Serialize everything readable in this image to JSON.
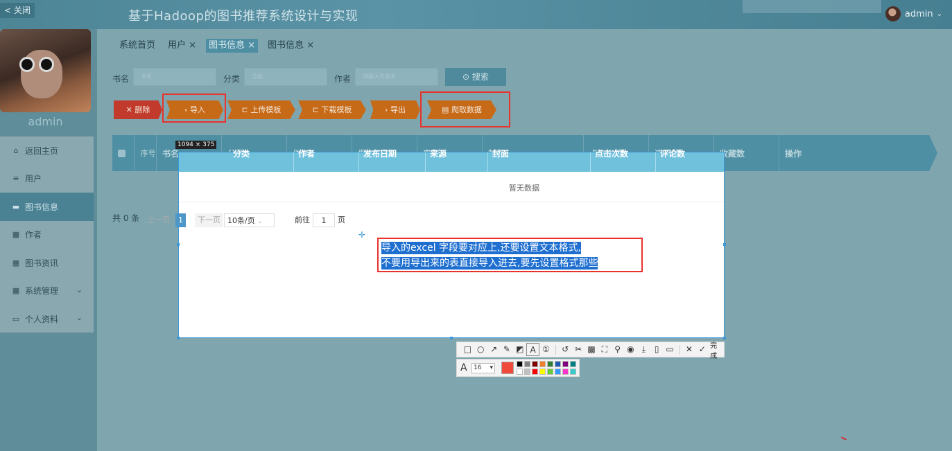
{
  "header": {
    "close_label": "< 关闭",
    "title": "基于Hadoop的图书推荐系统设计与实现",
    "username": "admin"
  },
  "sidebar": {
    "username": "admin",
    "items": [
      {
        "label": "返回主页",
        "icon": "home-icon"
      },
      {
        "label": "用户",
        "icon": "sliders-icon"
      },
      {
        "label": "图书信息",
        "icon": "monitor-icon",
        "active": true
      },
      {
        "label": "作者",
        "icon": "grid-icon"
      },
      {
        "label": "图书资讯",
        "icon": "grid-icon"
      },
      {
        "label": "系统管理",
        "icon": "grid-icon",
        "has_children": true
      },
      {
        "label": "个人资料",
        "icon": "card-icon",
        "has_children": true
      }
    ]
  },
  "tabs": [
    "系统首页",
    "用户",
    "图书信息",
    "图书信息"
  ],
  "filters": {
    "book_label": "书名",
    "book_placeholder": "书名",
    "category_label": "分类",
    "category_placeholder": "分类",
    "author_label": "作者",
    "author_placeholder": "请输入作者名",
    "search_label": "搜索"
  },
  "actions": [
    "删除",
    "导入",
    "上传模板",
    "下载模板",
    "导出",
    "爬取数据"
  ],
  "table": {
    "headers": [
      "序号",
      "书名",
      "分类",
      "作者",
      "发布日期",
      "来源",
      "封面",
      "点击次数",
      "评论数",
      "收藏数",
      "操作"
    ],
    "empty_text": "暂无数据"
  },
  "pager": {
    "total": "共 0 条",
    "prev": "上一页",
    "page": "1",
    "next": "下一页",
    "page_size": "10条/页",
    "goto_label": "前往",
    "goto_value": "1",
    "page_suffix": "页"
  },
  "capture": {
    "size_label": "1094 × 375",
    "note_line1": "导入的excel 字段要对应上,还要设置文本格式,",
    "note_line2": "不要用导出来的表直接导入进去,要先设置格式那些",
    "font_size": "16",
    "done_label": "完成",
    "current_color": "#f04a3c",
    "palette": [
      "#000000",
      "#808080",
      "#800000",
      "#f08030",
      "#2e7d32",
      "#1e5ab4",
      "#800080",
      "#008080",
      "#ffffff",
      "#c0c0c0",
      "#ff0000",
      "#ffff00",
      "#66cc33",
      "#3399ff",
      "#ff33cc",
      "#33cccc"
    ]
  }
}
